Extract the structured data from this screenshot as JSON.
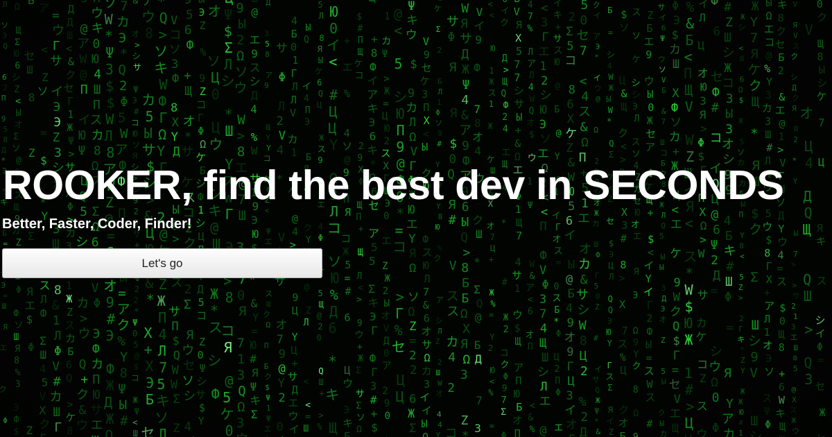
{
  "hero": {
    "headline": "ROOKER, find the best dev in SECONDS",
    "tagline": "Better, Faster, Coder, Finder!",
    "cta_label": "Let's go"
  },
  "background": {
    "style": "matrix code rain",
    "base_color": "#020402",
    "glyph_colors": [
      "#0b6b16",
      "#14a824",
      "#2bd83a",
      "#7dff8a"
    ]
  }
}
